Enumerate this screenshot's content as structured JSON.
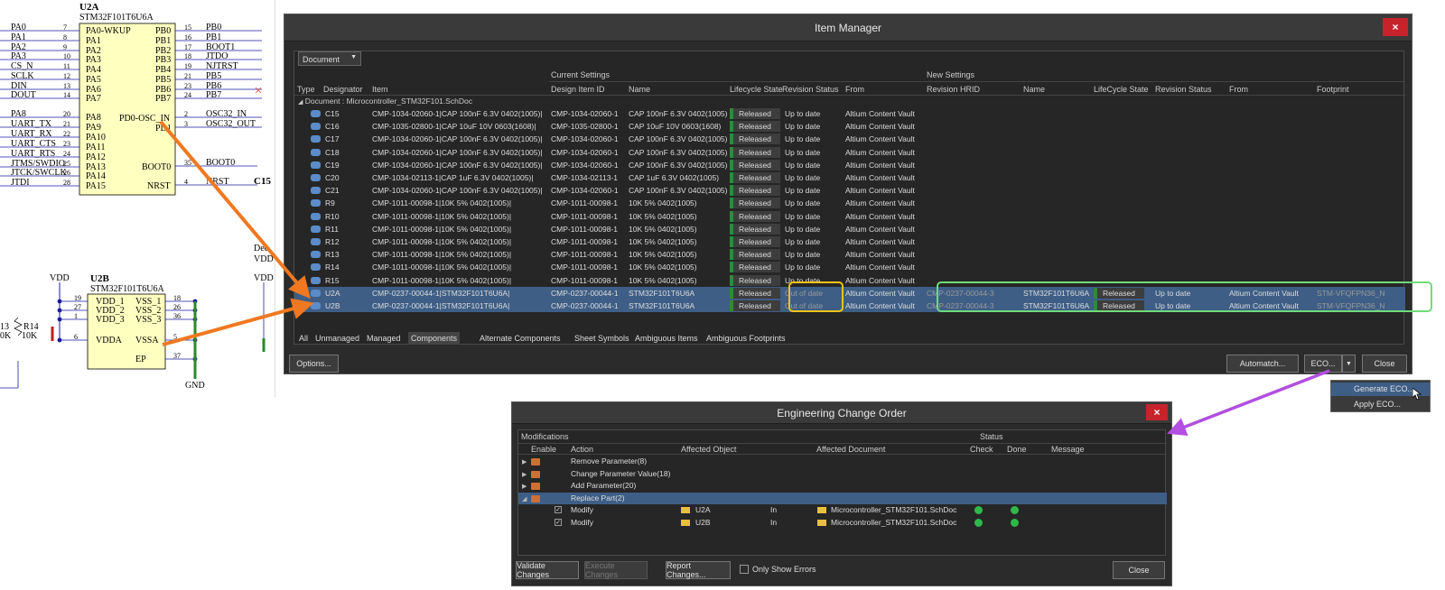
{
  "schematic": {
    "u2a": {
      "title": "U2A",
      "part": "STM32F101T6U6A",
      "left_nets": [
        "PA0",
        "PA1",
        "PA2",
        "PA3",
        "CS_N",
        "SCLK",
        "DIN",
        "DOUT",
        "PA8",
        "UART_TX",
        "UART_RX",
        "UART_CTS",
        "UART_RTS",
        "JTMS/SWDIO",
        "JTCK/SWCLK",
        "JTDI"
      ],
      "left_pins": [
        "7",
        "8",
        "9",
        "10",
        "11",
        "12",
        "13",
        "14",
        "20",
        "21",
        "22",
        "23",
        "24",
        "25",
        "26",
        "28"
      ],
      "left_labels": [
        "PA0-WKUP",
        "PA1",
        "PA2",
        "PA3",
        "PA4",
        "PA5",
        "PA6",
        "PA7",
        "PA8",
        "PA9",
        "PA10",
        "PA11",
        "PA12",
        "PA13",
        "PA14",
        "PA15"
      ],
      "right_labels": [
        "PB0",
        "PB1",
        "PB2",
        "PB3",
        "PB4",
        "PB5",
        "PB6",
        "PB7"
      ],
      "right_pins": [
        "15",
        "16",
        "17",
        "18",
        "19",
        "21",
        "23",
        "24"
      ],
      "right_nets": [
        "PB0",
        "PB1",
        "BOOT1",
        "JTDO",
        "NJTRST",
        "PB5",
        "PB6",
        "PB7"
      ],
      "osc_in_label": "PD0-OSC_IN",
      "osc_out_label": "PD1",
      "osc_pins": [
        "2",
        "3"
      ],
      "osc_nets": [
        "OSC32_IN",
        "OSC32_OUT"
      ],
      "boot0_label": "BOOT0",
      "boot0_pin": "35",
      "boot0_net": "BOOT0",
      "nrst_label": "NRST",
      "nrst_pin": "4",
      "nrst_net": "NRST",
      "c15_label": "C15"
    },
    "u2b": {
      "title": "U2B",
      "part": "STM32F101T6U6A",
      "left_labels": [
        "VDD_1",
        "VDD_2",
        "VDD_3",
        "VDDA"
      ],
      "left_pins": [
        "19",
        "27",
        "1",
        "6"
      ],
      "right_labels": [
        "VSS_1",
        "VSS_2",
        "VSS_3",
        "VSSA",
        "EP"
      ],
      "right_pins": [
        "18",
        "26",
        "36",
        "5",
        "37"
      ],
      "vdd": "VDD",
      "vdd2": "VDD",
      "gnd": "GND",
      "r13": "13",
      "r14": "R14",
      "r13v": "0K",
      "r14v": "10K",
      "dec": "Dec",
      "vdd3": "VDD"
    }
  },
  "item_manager": {
    "title": "Item Manager",
    "close_icon": "×",
    "filter_value": "Document",
    "group_current": "Current Settings",
    "group_new": "New Settings",
    "columns": [
      "Type",
      "Designator",
      "Item",
      "Design Item ID",
      "Name",
      "Lifecycle State",
      "Revision Status",
      "From",
      "Revision HRID",
      "Name",
      "LifeCycle State",
      "Revision Status",
      "From",
      "Footprint"
    ],
    "document_row": "Document : Microcontroller_STM32F101.SchDoc",
    "rows": [
      {
        "designator": "C15",
        "item": "CMP-1034-02060-1|CAP 100nF 6.3V 0402(1005)|",
        "id": "CMP-1034-02060-1",
        "name": "CAP 100nF 6.3V 0402(1005)",
        "life": "Released",
        "rev": "Up to date",
        "from": "Altium Content Vault"
      },
      {
        "designator": "C16",
        "item": "CMP-1035-02800-1|CAP 10uF 10V 0603(1608)|",
        "id": "CMP-1035-02800-1",
        "name": "CAP 10uF 10V 0603(1608)",
        "life": "Released",
        "rev": "Up to date",
        "from": "Altium Content Vault"
      },
      {
        "designator": "C17",
        "item": "CMP-1034-02060-1|CAP 100nF 6.3V 0402(1005)|",
        "id": "CMP-1034-02060-1",
        "name": "CAP 100nF 6.3V 0402(1005)",
        "life": "Released",
        "rev": "Up to date",
        "from": "Altium Content Vault"
      },
      {
        "designator": "C18",
        "item": "CMP-1034-02060-1|CAP 100nF 6.3V 0402(1005)|",
        "id": "CMP-1034-02060-1",
        "name": "CAP 100nF 6.3V 0402(1005)",
        "life": "Released",
        "rev": "Up to date",
        "from": "Altium Content Vault"
      },
      {
        "designator": "C19",
        "item": "CMP-1034-02060-1|CAP 100nF 6.3V 0402(1005)|",
        "id": "CMP-1034-02060-1",
        "name": "CAP 100nF 6.3V 0402(1005)",
        "life": "Released",
        "rev": "Up to date",
        "from": "Altium Content Vault"
      },
      {
        "designator": "C20",
        "item": "CMP-1034-02113-1|CAP 1uF 6.3V 0402(1005)|",
        "id": "CMP-1034-02113-1",
        "name": "CAP 1uF 6.3V 0402(1005)",
        "life": "Released",
        "rev": "Up to date",
        "from": "Altium Content Vault"
      },
      {
        "designator": "C21",
        "item": "CMP-1034-02060-1|CAP 100nF 6.3V 0402(1005)|",
        "id": "CMP-1034-02060-1",
        "name": "CAP 100nF 6.3V 0402(1005)",
        "life": "Released",
        "rev": "Up to date",
        "from": "Altium Content Vault"
      },
      {
        "designator": "R9",
        "item": "CMP-1011-00098-1|10K 5% 0402(1005)|",
        "id": "CMP-1011-00098-1",
        "name": "10K 5% 0402(1005)",
        "life": "Released",
        "rev": "Up to date",
        "from": "Altium Content Vault"
      },
      {
        "designator": "R10",
        "item": "CMP-1011-00098-1|10K 5% 0402(1005)|",
        "id": "CMP-1011-00098-1",
        "name": "10K 5% 0402(1005)",
        "life": "Released",
        "rev": "Up to date",
        "from": "Altium Content Vault"
      },
      {
        "designator": "R11",
        "item": "CMP-1011-00098-1|10K 5% 0402(1005)|",
        "id": "CMP-1011-00098-1",
        "name": "10K 5% 0402(1005)",
        "life": "Released",
        "rev": "Up to date",
        "from": "Altium Content Vault"
      },
      {
        "designator": "R12",
        "item": "CMP-1011-00098-1|10K 5% 0402(1005)|",
        "id": "CMP-1011-00098-1",
        "name": "10K 5% 0402(1005)",
        "life": "Released",
        "rev": "Up to date",
        "from": "Altium Content Vault"
      },
      {
        "designator": "R13",
        "item": "CMP-1011-00098-1|10K 5% 0402(1005)|",
        "id": "CMP-1011-00098-1",
        "name": "10K 5% 0402(1005)",
        "life": "Released",
        "rev": "Up to date",
        "from": "Altium Content Vault"
      },
      {
        "designator": "R14",
        "item": "CMP-1011-00098-1|10K 5% 0402(1005)|",
        "id": "CMP-1011-00098-1",
        "name": "10K 5% 0402(1005)",
        "life": "Released",
        "rev": "Up to date",
        "from": "Altium Content Vault"
      },
      {
        "designator": "R15",
        "item": "CMP-1011-00098-1|10K 5% 0402(1005)|",
        "id": "CMP-1011-00098-1",
        "name": "10K 5% 0402(1005)",
        "life": "Released",
        "rev": "Up to date",
        "from": "Altium Content Vault"
      }
    ],
    "selected_rows": [
      {
        "designator": "U2A",
        "item": "CMP-0237-00044-1|STM32F101T6U6A|",
        "id": "CMP-0237-00044-1",
        "name": "STM32F101T6U6A",
        "life": "Released",
        "rev": "Out of date",
        "from": "Altium Content Vault",
        "new_hrid": "CMP-0237-00044-3",
        "new_name": "STM32F101T6U6A",
        "new_life": "Released",
        "new_rev": "Up to date",
        "new_from": "Altium Content Vault",
        "new_fp": "STM-VFQFPN36_N"
      },
      {
        "designator": "U2B",
        "item": "CMP-0237-00044-1|STM32F101T6U6A|",
        "id": "CMP-0237-00044-1",
        "name": "STM32F101T6U6A",
        "life": "Released",
        "rev": "Out of date",
        "from": "Altium Content Vault",
        "new_hrid": "CMP-0237-00044-3",
        "new_name": "STM32F101T6U6A",
        "new_life": "Released",
        "new_rev": "Up to date",
        "new_from": "Altium Content Vault",
        "new_fp": "STM-VFQFPN36_N"
      }
    ],
    "tabs": [
      "All",
      "Unmanaged",
      "Managed",
      "Components",
      "Alternate Components",
      "Sheet Symbols",
      "Ambiguous Items",
      "Ambiguous Footprints"
    ],
    "active_tab": "Components",
    "options_button": "Options...",
    "automatch_button": "Automatch...",
    "eco_button": "ECO...",
    "close_button": "Close",
    "eco_menu": [
      "Generate ECO...",
      "Apply ECO..."
    ]
  },
  "eco": {
    "title": "Engineering Change Order",
    "close_icon": "×",
    "group_modifications": "Modifications",
    "group_status": "Status",
    "columns": [
      "Enable",
      "Action",
      "Affected Object",
      "Affected Document",
      "Check",
      "Done",
      "Message"
    ],
    "groups": [
      "Remove Parameter(8)",
      "Change Parameter Value(18)",
      "Add Parameter(20)",
      "Replace Part(2)"
    ],
    "items": [
      {
        "action": "Modify",
        "object": "U2A",
        "in": "In",
        "document": "Microcontroller_STM32F101.SchDoc"
      },
      {
        "action": "Modify",
        "object": "U2B",
        "in": "In",
        "document": "Microcontroller_STM32F101.SchDoc"
      }
    ],
    "validate_button": "Validate Changes",
    "execute_button": "Execute Changes",
    "report_button": "Report Changes...",
    "only_errors_label": "Only Show Errors",
    "close_button": "Close"
  },
  "colors": {
    "orange_arrow": "#f07820",
    "purple_arrow": "#b24ee0",
    "yellow_highlight": "#f2c418",
    "green_highlight": "#6fdc7a",
    "selected_row": "#3e5e86",
    "released_bar": "#2f8a3b"
  }
}
